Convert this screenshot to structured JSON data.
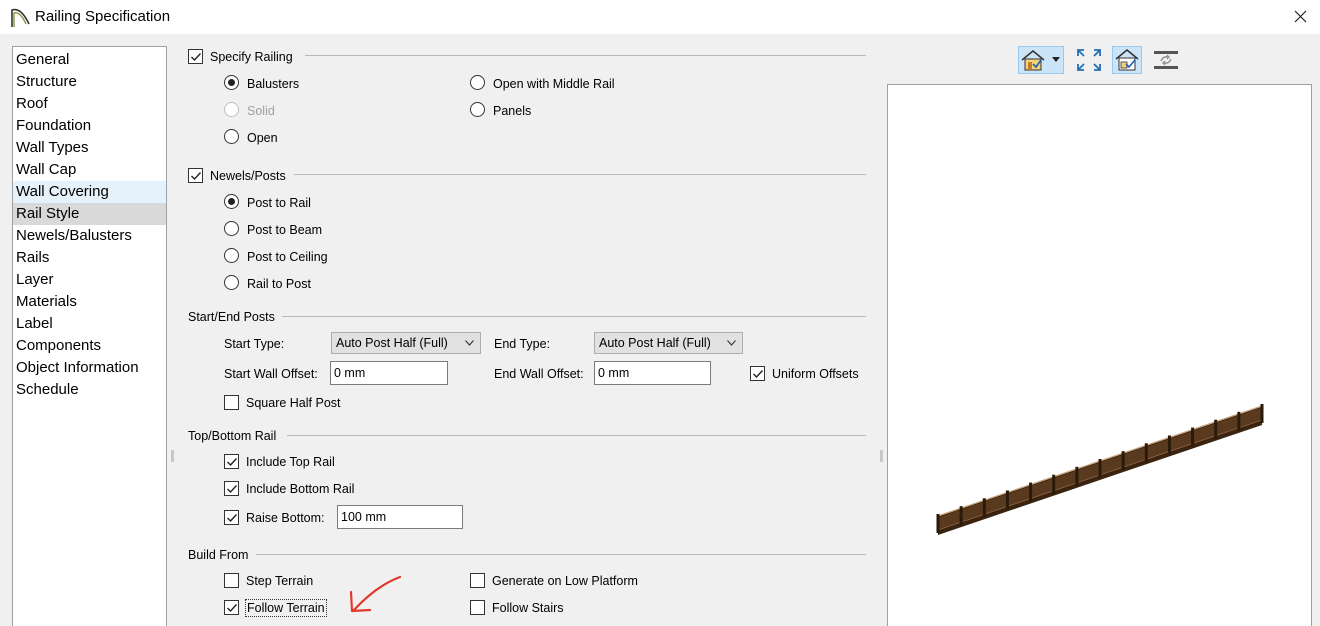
{
  "window": {
    "title": "Railing Specification"
  },
  "nav": {
    "items": [
      {
        "label": "General"
      },
      {
        "label": "Structure"
      },
      {
        "label": "Roof"
      },
      {
        "label": "Foundation"
      },
      {
        "label": "Wall Types"
      },
      {
        "label": "Wall Cap"
      },
      {
        "label": "Wall Covering"
      },
      {
        "label": "Rail Style"
      },
      {
        "label": "Newels/Balusters"
      },
      {
        "label": "Rails"
      },
      {
        "label": "Layer"
      },
      {
        "label": "Materials"
      },
      {
        "label": "Label"
      },
      {
        "label": "Components"
      },
      {
        "label": "Object Information"
      },
      {
        "label": "Schedule"
      }
    ],
    "selected": "Rail Style",
    "hovered": "Wall Covering"
  },
  "specify_railing": {
    "label": "Specify Railing",
    "checked": true,
    "options": {
      "balusters": {
        "label": "Balusters",
        "checked": true
      },
      "solid": {
        "label": "Solid",
        "disabled": true
      },
      "open": {
        "label": "Open"
      },
      "open_middle": {
        "label": "Open with Middle Rail"
      },
      "panels": {
        "label": "Panels"
      }
    }
  },
  "newels": {
    "label": "Newels/Posts",
    "checked": true,
    "options": {
      "post_to_rail": {
        "label": "Post to Rail",
        "checked": true
      },
      "post_to_beam": {
        "label": "Post to Beam"
      },
      "post_to_ceiling": {
        "label": "Post to Ceiling"
      },
      "rail_to_post": {
        "label": "Rail to Post"
      }
    }
  },
  "start_end": {
    "title": "Start/End Posts",
    "start_type_label": "Start Type:",
    "start_type_value": "Auto Post Half (Full)",
    "end_type_label": "End Type:",
    "end_type_value": "Auto Post Half (Full)",
    "start_offset_label": "Start Wall Offset:",
    "start_offset_value": "0 mm",
    "end_offset_label": "End Wall Offset:",
    "end_offset_value": "0 mm",
    "uniform_label": "Uniform Offsets",
    "uniform_checked": true,
    "square_label": "Square Half Post",
    "square_checked": false
  },
  "top_bottom": {
    "title": "Top/Bottom Rail",
    "include_top_label": "Include Top Rail",
    "include_top_checked": true,
    "include_bottom_label": "Include Bottom Rail",
    "include_bottom_checked": true,
    "raise_label": "Raise Bottom:",
    "raise_checked": true,
    "raise_value": "100 mm"
  },
  "build_from": {
    "title": "Build From",
    "step_label": "Step Terrain",
    "step_checked": false,
    "follow_terrain_label": "Follow Terrain",
    "follow_terrain_checked": true,
    "low_platform_label": "Generate on Low Platform",
    "low_platform_checked": false,
    "follow_stairs_label": "Follow Stairs",
    "follow_stairs_checked": false
  },
  "annotation": {
    "arrow_color": "#e03a2f"
  },
  "preview": {
    "tools": [
      "view-style-icon",
      "fill-window-icon",
      "color-toggle-icon",
      "layer-reset-icon"
    ],
    "rail_color": "#5a3a1e"
  }
}
